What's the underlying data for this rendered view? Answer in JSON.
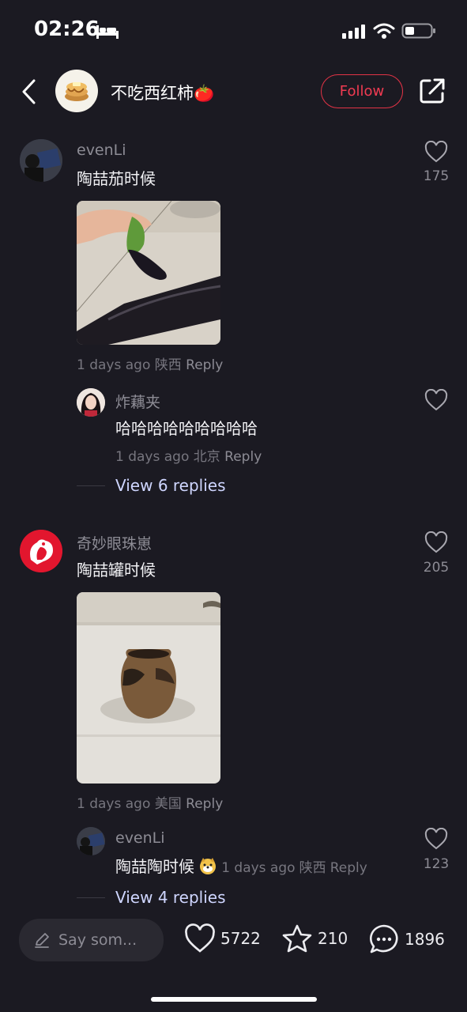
{
  "status_bar": {
    "time": "02:26"
  },
  "header": {
    "username": "不吃西红柿🍅",
    "follow_label": "Follow"
  },
  "comments": [
    {
      "user": "evenLi",
      "text": "陶喆茄时候",
      "likes": "175",
      "meta_time": "1 days ago",
      "meta_location": "陕西",
      "reply_label": "Reply",
      "replies": [
        {
          "user": "炸藕夹",
          "text": "哈哈哈哈哈哈哈哈哈",
          "meta_time": "1 days ago",
          "meta_location": "北京",
          "reply_label": "Reply"
        }
      ],
      "view_replies": "View 6 replies"
    },
    {
      "user": "奇妙眼珠崽",
      "text": "陶喆罐时候",
      "likes": "205",
      "meta_time": "1 days ago",
      "meta_location": "美国",
      "reply_label": "Reply",
      "replies": [
        {
          "user": "evenLi",
          "text": "陶喆陶时候",
          "meta_time": "1 days ago",
          "meta_location": "陕西",
          "reply_label": "Reply",
          "likes": "123"
        }
      ],
      "view_replies": "View 4 replies"
    }
  ],
  "bottom_bar": {
    "input_placeholder": "Say som...",
    "likes": "5722",
    "favorites": "210",
    "comments": "1896"
  },
  "colors": {
    "background": "#1b1a22",
    "accent": "#f13b52",
    "link": "#cfd6ff"
  }
}
